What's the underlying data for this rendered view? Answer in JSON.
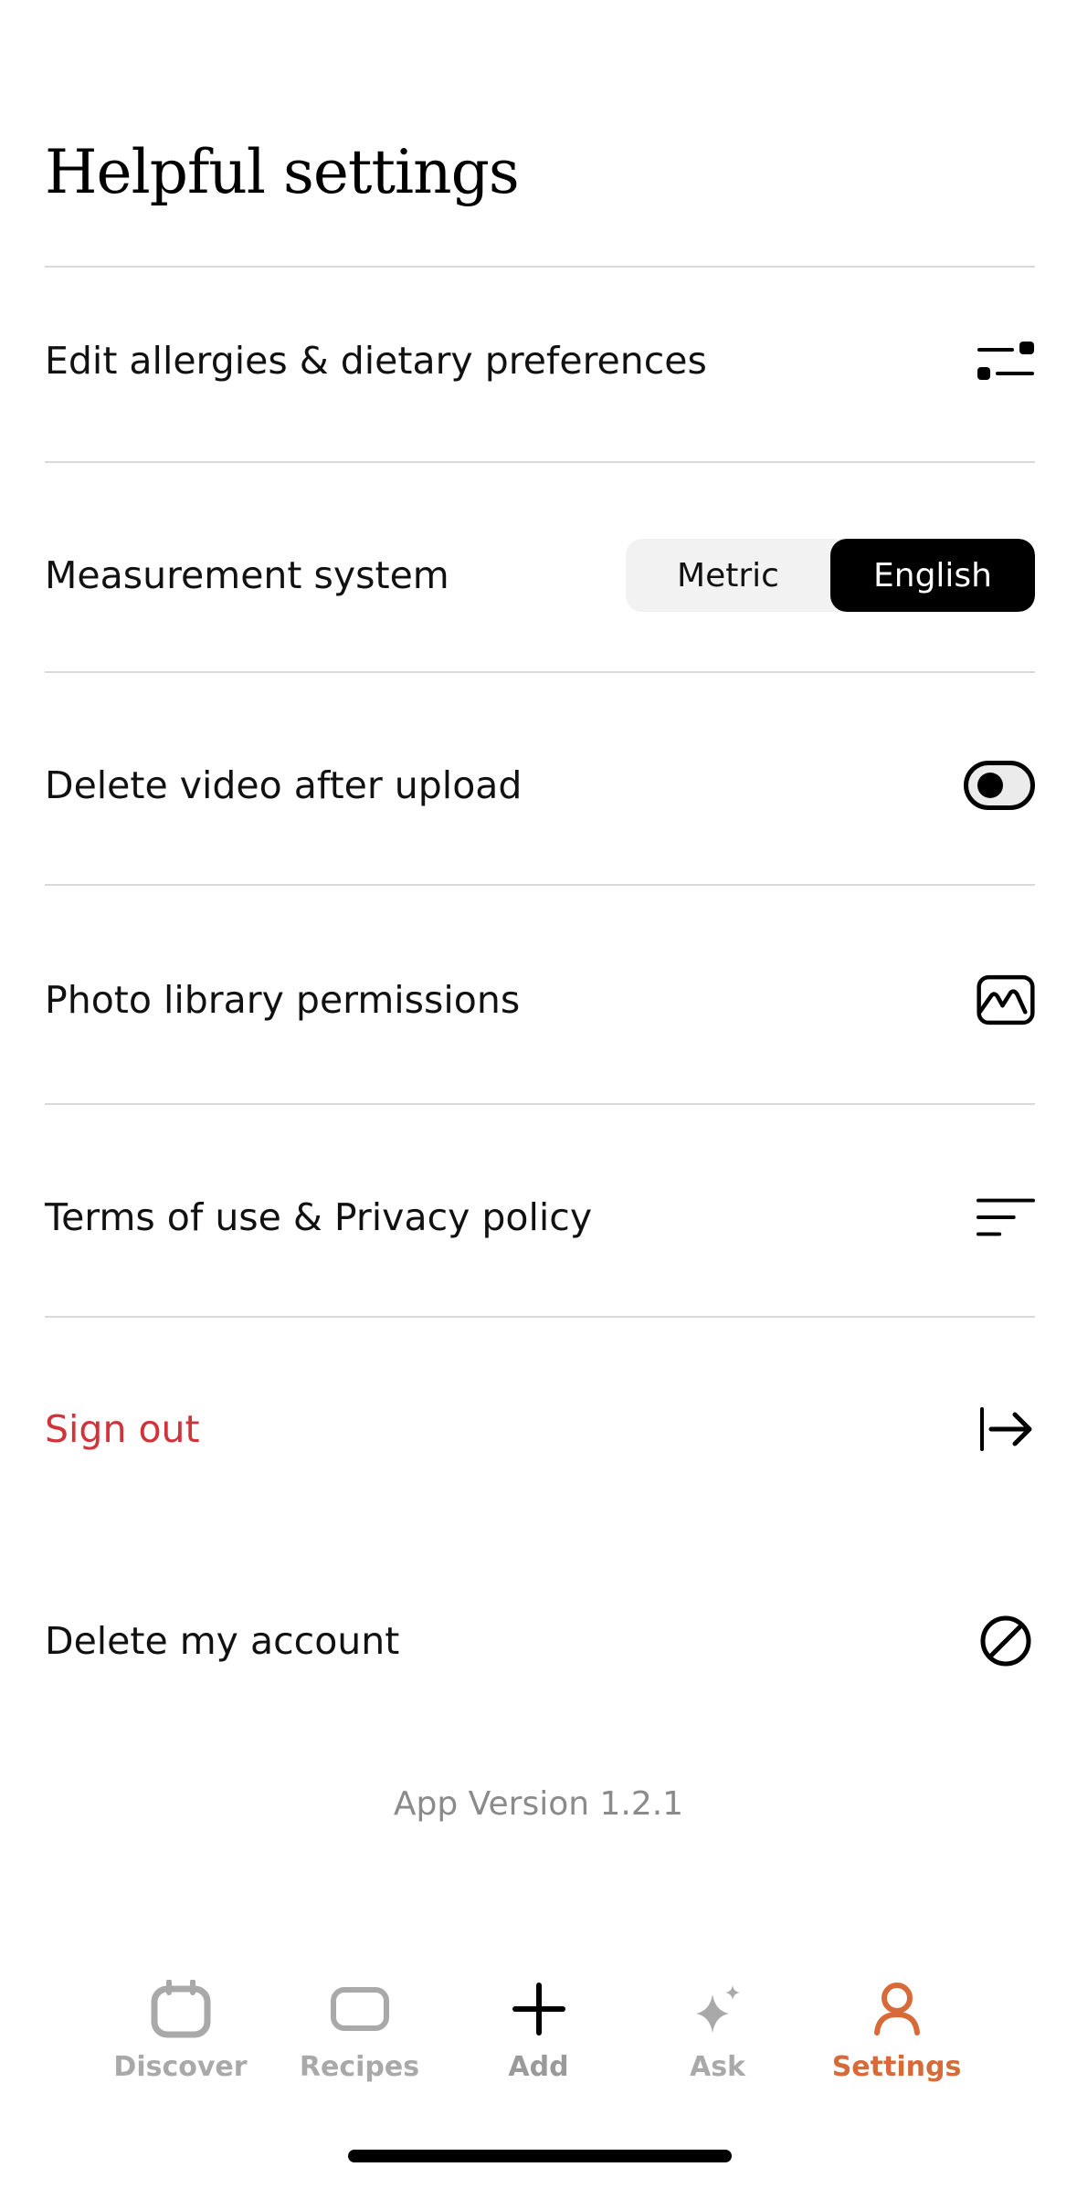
{
  "header": {
    "title": "Helpful settings"
  },
  "rows": {
    "allergies": {
      "label": "Edit allergies & dietary preferences",
      "icon": "sliders-icon"
    },
    "measurement": {
      "label": "Measurement system",
      "options": [
        "Metric",
        "English"
      ],
      "selected": "English"
    },
    "delete_video": {
      "label": "Delete video after upload",
      "toggle_on": false
    },
    "photo_library": {
      "label": "Photo library permissions",
      "icon": "photo-icon"
    },
    "terms": {
      "label": "Terms of use & Privacy policy",
      "icon": "text-lines-icon"
    },
    "sign_out": {
      "label": "Sign out",
      "icon": "sign-out-icon"
    },
    "delete_account": {
      "label": "Delete my account",
      "icon": "prohibited-icon"
    }
  },
  "footer": {
    "version": "App Version 1.2.1"
  },
  "tabbar": {
    "tabs": [
      {
        "label": "Discover",
        "icon": "calendar-icon"
      },
      {
        "label": "Recipes",
        "icon": "card-icon"
      },
      {
        "label": "Add",
        "icon": "plus-icon"
      },
      {
        "label": "Ask",
        "icon": "sparkle-icon"
      },
      {
        "label": "Settings",
        "icon": "person-icon"
      }
    ],
    "active": "Settings"
  },
  "colors": {
    "accent": "#d86a3a",
    "danger": "#d0343a",
    "muted": "#a9a9a9",
    "divider": "#d9d9d9"
  }
}
